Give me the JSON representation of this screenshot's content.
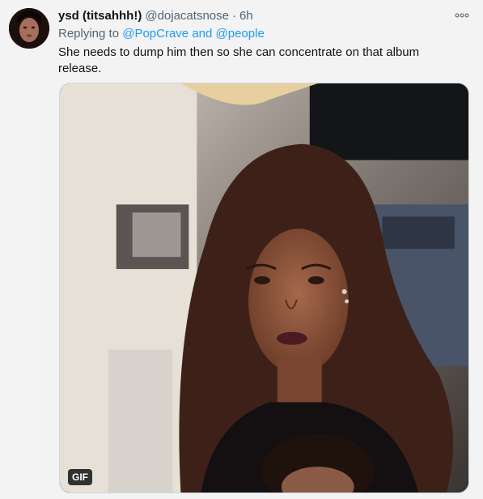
{
  "tweet": {
    "display_name": "ysd (titsahhh!)",
    "handle": "@dojacatsnose",
    "separator": "·",
    "time": "6h",
    "replying_prefix": "Replying to",
    "reply_mentions": "@PopCrave and @people",
    "text": "She needs to dump him then so she can concentrate on that album release.",
    "more_icon": "more-horizontal-icon",
    "avatar": "user-avatar"
  },
  "media": {
    "type": "gif",
    "badge": "GIF"
  },
  "colors": {
    "background": "#f3f3f4",
    "link": "#1d9bf0",
    "secondary_text": "#536471",
    "primary_text": "#0f1419"
  }
}
